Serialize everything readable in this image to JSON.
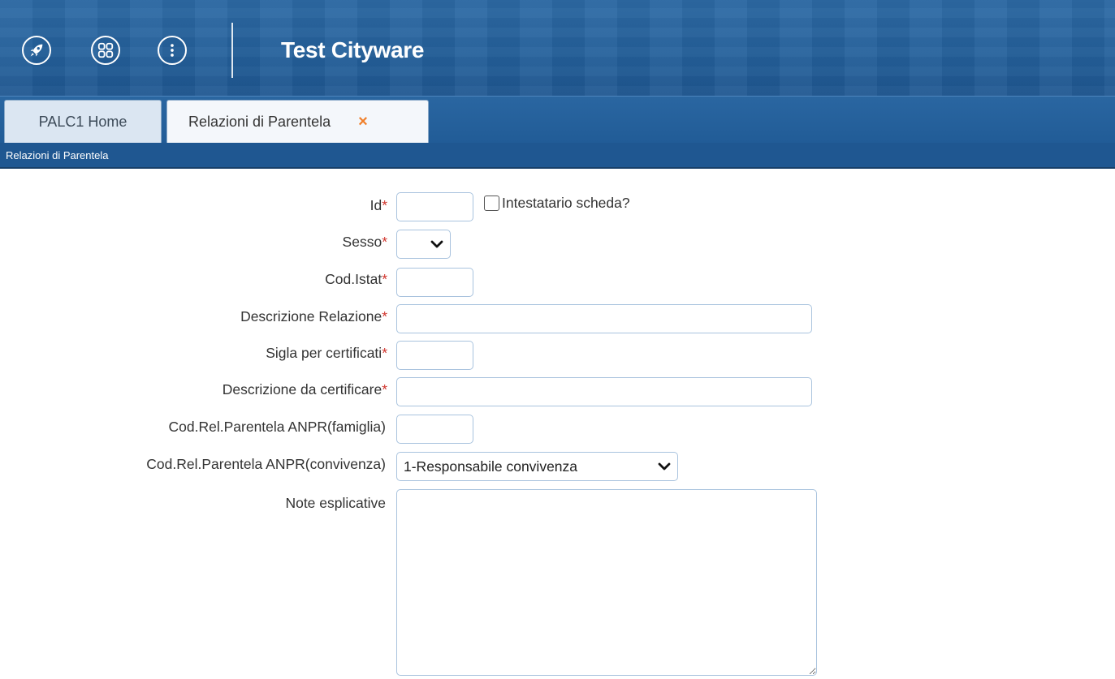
{
  "header": {
    "app_title": "Test Cityware",
    "icons": [
      "rocket-icon",
      "apps-grid-icon",
      "more-vertical-icon"
    ]
  },
  "tabs": [
    {
      "label": "PALC1 Home",
      "active": false
    },
    {
      "label": "Relazioni di Parentela",
      "active": true,
      "close": "×"
    }
  ],
  "subtitle": "Relazioni di Parentela",
  "form": {
    "required_mark": "*",
    "id": {
      "label": "Id",
      "value": ""
    },
    "intestatario": {
      "label": "Intestatario scheda?",
      "checked": false
    },
    "sesso": {
      "label": "Sesso",
      "value": ""
    },
    "cod_istat": {
      "label": "Cod.Istat",
      "value": ""
    },
    "descrizione_relazione": {
      "label": "Descrizione Relazione",
      "value": ""
    },
    "sigla_certificati": {
      "label": "Sigla per certificati",
      "value": ""
    },
    "descrizione_certificare": {
      "label": "Descrizione da certificare",
      "value": ""
    },
    "anpr_famiglia": {
      "label": "Cod.Rel.Parentela ANPR(famiglia)",
      "value": ""
    },
    "anpr_convivenza": {
      "label": "Cod.Rel.Parentela ANPR(convivenza)",
      "value": "1-Responsabile convivenza"
    },
    "note": {
      "label": "Note esplicative",
      "value": ""
    }
  },
  "colors": {
    "header_blue": "#24609b",
    "required_red": "#d0342c",
    "close_orange": "#f07f2a",
    "field_border": "#a9c3de"
  }
}
